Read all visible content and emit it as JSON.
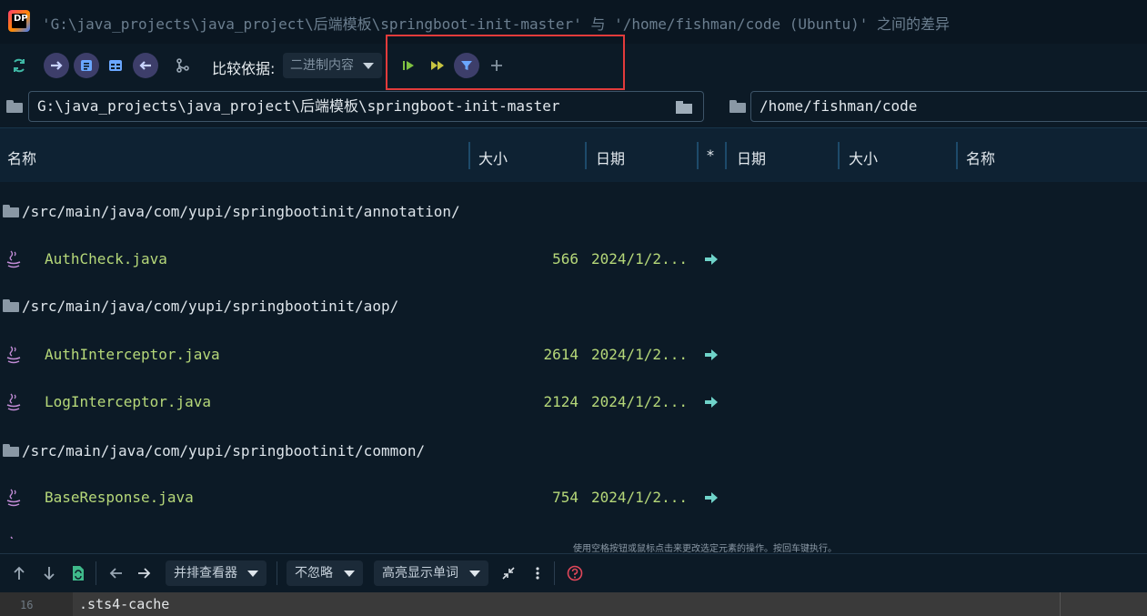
{
  "window": {
    "app_icon_label": "DP",
    "title": "'G:\\java_projects\\java_project\\后端模板\\springboot-init-master' 与 '/home/fishman/code (Ubuntu)' 之间的差异"
  },
  "toolbar": {
    "compare_label": "比较依据:",
    "compare_value": "二进制内容",
    "icons": [
      "refresh-icon",
      "arrow-right-icon",
      "list-icon",
      "columns-icon",
      "arrow-left-icon",
      "branch-icon",
      "run-icon",
      "run-all-icon",
      "filter-icon",
      "plus-icon"
    ],
    "accent_color": "#3d3e6a"
  },
  "paths": {
    "left": "G:\\java_projects\\java_project\\后端模板\\springboot-init-master",
    "right": "/home/fishman/code"
  },
  "columns": {
    "left_name": "名称",
    "left_size": "大小",
    "left_date": "日期",
    "star": "*",
    "right_date": "日期",
    "right_size": "大小",
    "right_name": "名称"
  },
  "rows": [
    {
      "type": "dir",
      "path": "/src/main/java/com/yupi/springbootinit/annotation/"
    },
    {
      "type": "file",
      "name": "AuthCheck.java",
      "size": "566",
      "date": "2024/1/2..."
    },
    {
      "type": "dir",
      "path": "/src/main/java/com/yupi/springbootinit/aop/"
    },
    {
      "type": "file",
      "name": "AuthInterceptor.java",
      "size": "2614",
      "date": "2024/1/2..."
    },
    {
      "type": "file",
      "name": "LogInterceptor.java",
      "size": "2124",
      "date": "2024/1/2..."
    },
    {
      "type": "dir",
      "path": "/src/main/java/com/yupi/springbootinit/common/"
    },
    {
      "type": "file",
      "name": "BaseResponse.java",
      "size": "754",
      "date": "2024/1/2..."
    }
  ],
  "status": {
    "hint": "使用空格按钮或鼠标点击来更改选定元素的操作。按回车键执行。"
  },
  "bottom": {
    "viewer_mode": "并排查看器",
    "ignore_mode": "不忽略",
    "highlight_mode": "高亮显示单词"
  },
  "editor": {
    "line_number": "16",
    "code": ".sts4-cache"
  },
  "colors": {
    "file_text": "#b6d879",
    "header_bg": "#0e2233",
    "highlight_box": "#e23b3b",
    "arrow": "#6fd3c9"
  }
}
